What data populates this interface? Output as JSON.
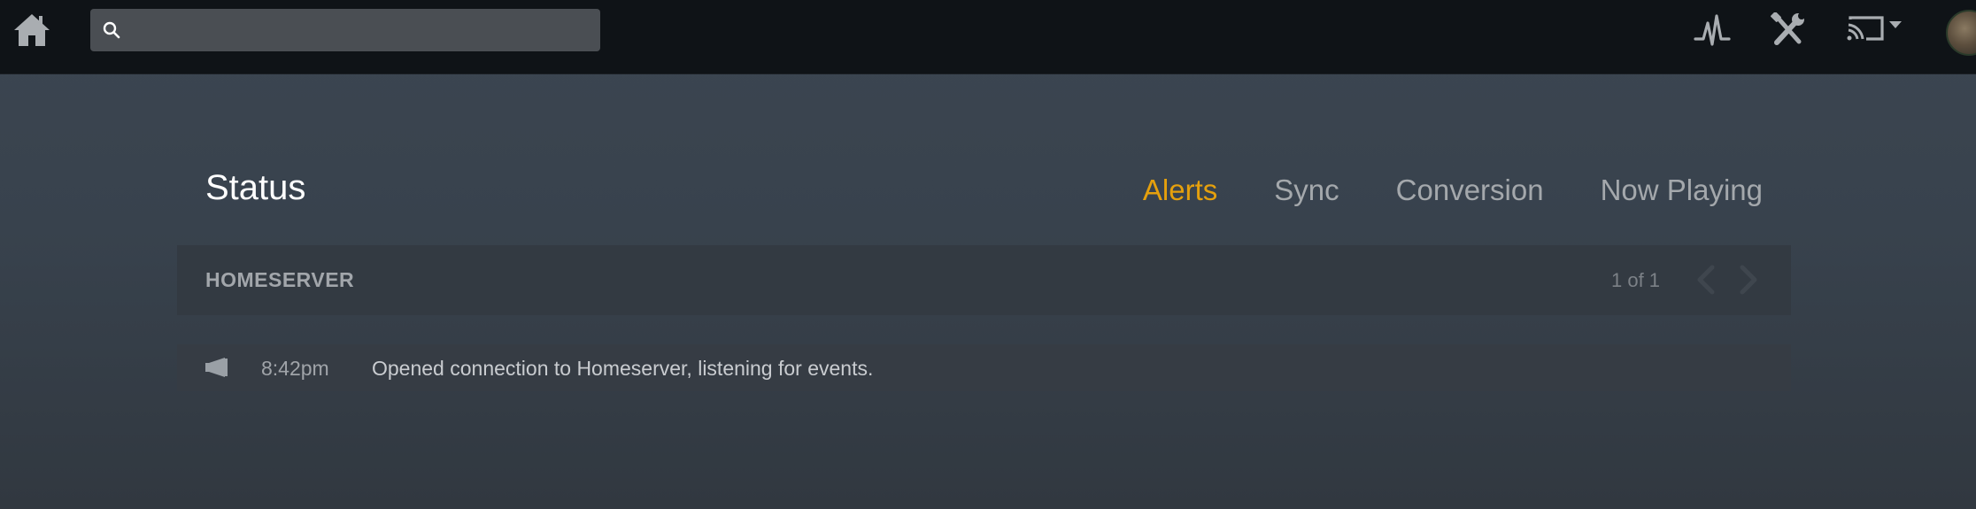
{
  "topbar": {
    "home_icon": "home-icon",
    "search": {
      "icon": "search-icon",
      "placeholder": "",
      "value": ""
    },
    "activity_icon": "activity-icon",
    "settings_icon": "wrench-screwdriver-icon",
    "cast_icon": "cast-icon",
    "avatar_icon": "user-avatar"
  },
  "page": {
    "title": "Status",
    "tabs": [
      {
        "label": "Alerts",
        "active": true
      },
      {
        "label": "Sync",
        "active": false
      },
      {
        "label": "Conversion",
        "active": false
      },
      {
        "label": "Now Playing",
        "active": false
      }
    ]
  },
  "server": {
    "name": "HOMESERVER",
    "pagination": "1 of 1"
  },
  "alerts": [
    {
      "icon": "megaphone-icon",
      "time": "8:42pm",
      "message": "Opened connection to Homeserver, listening for events."
    }
  ],
  "colors": {
    "accent": "#e5a00d",
    "topbar": "#0f1317",
    "background": "#3a444f"
  }
}
